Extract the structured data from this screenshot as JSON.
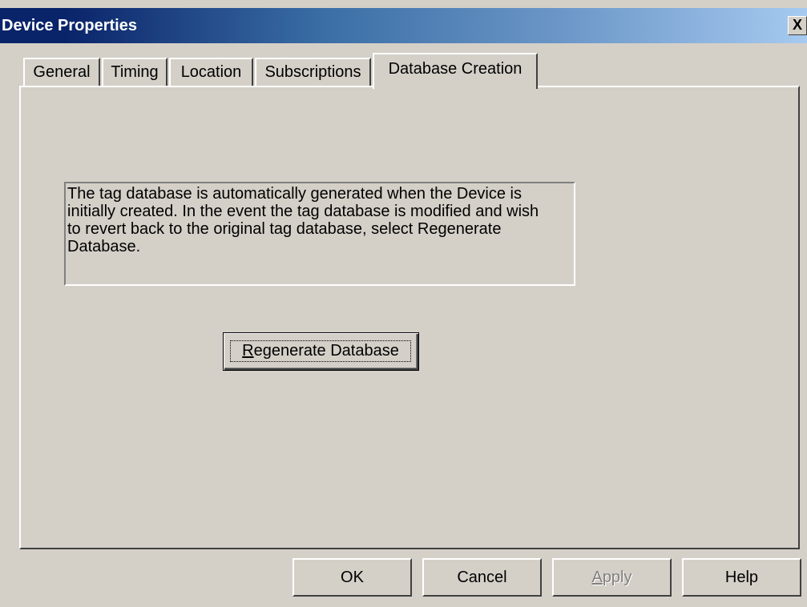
{
  "window": {
    "title": "Device Properties",
    "close_symbol": "X"
  },
  "tabs": [
    {
      "label": "General",
      "active": false
    },
    {
      "label": "Timing",
      "active": false
    },
    {
      "label": "Location",
      "active": false
    },
    {
      "label": "Subscriptions",
      "active": false
    },
    {
      "label": "Database Creation",
      "active": true
    }
  ],
  "panel": {
    "info_text": "The tag database is automatically generated when the Device is\ninitially created.  In the event the tag database is modified and wish\nto revert back to the original tag database, select Regenerate\nDatabase.",
    "regenerate_button": {
      "mnemonic": "R",
      "label_rest": "egenerate Database"
    }
  },
  "buttons": {
    "ok": "OK",
    "cancel": "Cancel",
    "apply_mnemonic": "A",
    "apply_rest": "pply",
    "apply_enabled": false,
    "help": "Help"
  },
  "colors": {
    "face": "#d4d0c8",
    "title_start": "#0a246a",
    "title_end": "#a6caf0",
    "disabled_text": "#808080"
  }
}
